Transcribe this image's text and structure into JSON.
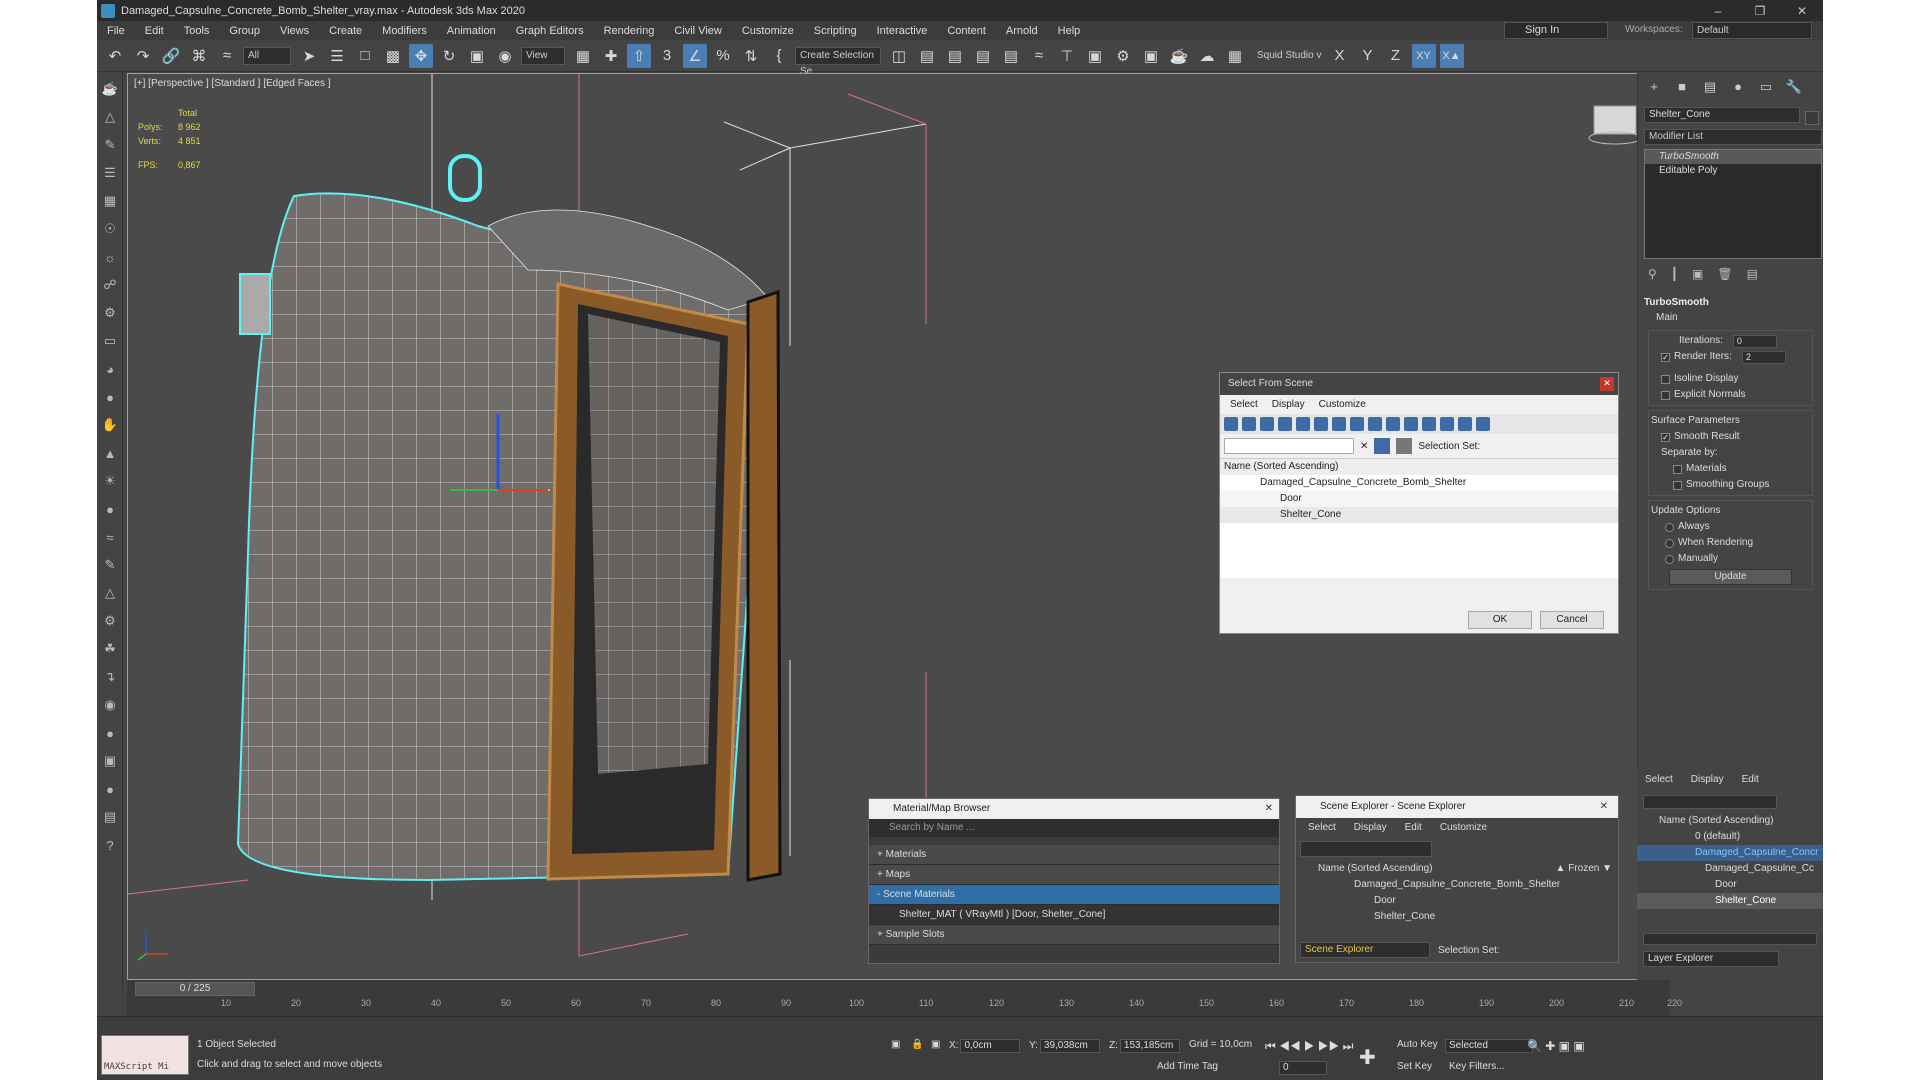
{
  "title": "Damaged_Capsulne_Concrete_Bomb_Shelter_vray.max - Autodesk 3ds Max 2020",
  "menu": [
    "File",
    "Edit",
    "Tools",
    "Group",
    "Views",
    "Create",
    "Modifiers",
    "Animation",
    "Graph Editors",
    "Rendering",
    "Civil View",
    "Customize",
    "Scripting",
    "Interactive",
    "Content",
    "Arnold",
    "Help"
  ],
  "signin": "Sign In",
  "workspaces_label": "Workspaces:",
  "workspace": "Default",
  "toolbar": {
    "filter": "All",
    "view": "View",
    "selset": "Create Selection Se",
    "squid": "Squid Studio v",
    "axes": [
      "X",
      "Y",
      "Z",
      "XY"
    ]
  },
  "viewport": {
    "label": "[+] [Perspective ] [Standard ] [Edged Faces ]",
    "total": "Total",
    "polys_k": "Polys:",
    "polys_v": "8 962",
    "verts_k": "Verts:",
    "verts_v": "4 851",
    "fps_k": "FPS:",
    "fps_v": "0,867"
  },
  "cmd": {
    "object_name": "Shelter_Cone",
    "modifier_list": "Modifier List",
    "stack": [
      "TurboSmooth",
      "Editable Poly"
    ],
    "ts_title": "TurboSmooth",
    "main": "Main",
    "iterations": "Iterations:",
    "iterations_v": "0",
    "render_iters": "Render Iters:",
    "render_iters_v": "2",
    "isoline": "Isoline Display",
    "explicit": "Explicit Normals",
    "surface": "Surface Parameters",
    "smooth": "Smooth Result",
    "separate": "Separate by:",
    "materials": "Materials",
    "smoothing": "Smoothing Groups",
    "update_opts": "Update Options",
    "always": "Always",
    "when_rendering": "When Rendering",
    "manually": "Manually",
    "update": "Update"
  },
  "sfs": {
    "title": "Select From Scene",
    "menu": [
      "Select",
      "Display",
      "Customize"
    ],
    "selection_set": "Selection Set:",
    "col": "Name (Sorted Ascending)",
    "root": "Damaged_Capsulne_Concrete_Bomb_Shelter",
    "items": [
      "Door",
      "Shelter_Cone"
    ],
    "ok": "OK",
    "cancel": "Cancel"
  },
  "mb": {
    "title": "Material/Map Browser",
    "search": "Search by Name ...",
    "rows": [
      "+ Materials",
      "+ Maps",
      "- Scene Materials"
    ],
    "mat": "Shelter_MAT  ( VRayMtl ) [Door, Shelter_Cone]",
    "slots": "+ Sample Slots"
  },
  "sx": {
    "title": "Scene Explorer - Scene Explorer",
    "menu": [
      "Select",
      "Display",
      "Edit",
      "Customize"
    ],
    "col": "Name (Sorted Ascending)",
    "frozen": "▲ Frozen ▼",
    "root": "Damaged_Capsulne_Concrete_Bomb_Shelter",
    "items": [
      "Door",
      "Shelter_Cone"
    ],
    "footer": "Scene Explorer",
    "selection_set": "Selection Set:"
  },
  "layer": {
    "menu": [
      "Select",
      "Display",
      "Edit"
    ],
    "col": "Name (Sorted Ascending)",
    "rows": [
      "0 (default)",
      "Damaged_Capsulne_Concr",
      "Damaged_Capsulne_Cc",
      "Door",
      "Shelter_Cone"
    ],
    "footer": "Layer Explorer"
  },
  "timeline": {
    "frame": "0 / 225",
    "ticks": [
      "10",
      "20",
      "30",
      "40",
      "50",
      "60",
      "70",
      "80",
      "90",
      "100",
      "110",
      "120",
      "130",
      "140",
      "150",
      "160",
      "170",
      "180",
      "190",
      "200",
      "210",
      "220"
    ]
  },
  "status": {
    "maxscript": "MAXScript Mi",
    "selected": "1 Object Selected",
    "hint": "Click and drag to select and move objects",
    "x_k": "X:",
    "x": "0,0cm",
    "y_k": "Y:",
    "y": "39,038cm",
    "z_k": "Z:",
    "z": "153,185cm",
    "grid": "Grid = 10,0cm",
    "add_tag": "Add Time Tag",
    "auto_key": "Auto Key",
    "set_key": "Set Key",
    "selected_dd": "Selected",
    "key_filters": "Key Filters...",
    "frame_v": "0"
  }
}
